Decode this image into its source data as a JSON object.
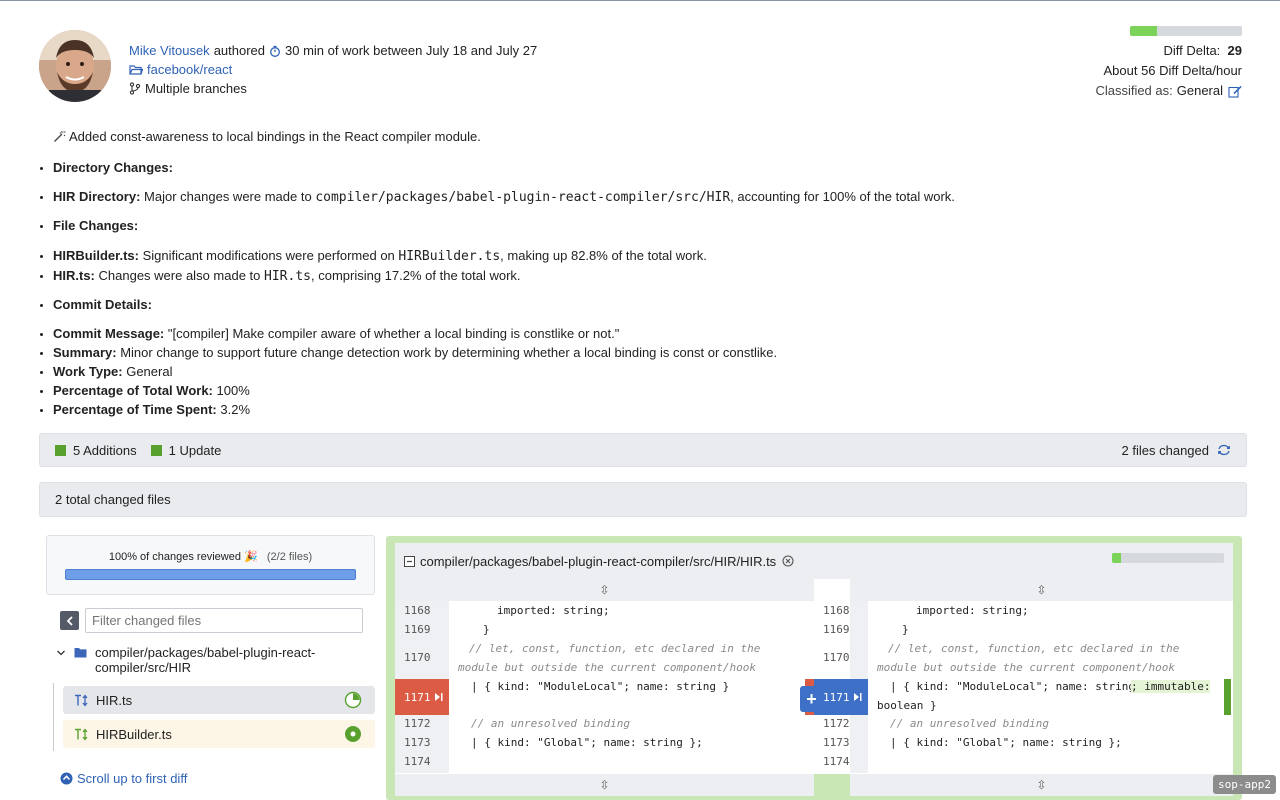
{
  "author": {
    "name": "Mike Vitousek",
    "authored_label": "authored",
    "work_text": "30 min of work between July 18 and July 27",
    "repo": "facebook/react",
    "branches": "Multiple branches"
  },
  "metrics": {
    "diff_delta_label": "Diff Delta:",
    "diff_delta_value": "29",
    "diff_delta_fill": 0.24,
    "rate": "About 56 Diff Delta/hour",
    "classified_label": "Classified as:",
    "classified_value": "General"
  },
  "summary": {
    "lead": "Added const-awareness to local bindings in the React compiler module.",
    "directory_heading": "Directory Changes:",
    "hir_dir_label": "HIR Directory:",
    "hir_dir_pre": "Major changes were made to",
    "hir_dir_path": "compiler/packages/babel-plugin-react-compiler/src/HIR",
    "hir_dir_post": ", accounting for 100% of the total work.",
    "file_heading": "File Changes:",
    "builder_label": "HIRBuilder.ts:",
    "builder_pre": "Significant modifications were performed on",
    "builder_file": "HIRBuilder.ts",
    "builder_post": ", making up 82.8% of the total work.",
    "hir_label": "HIR.ts:",
    "hir_pre": "Changes were also made to",
    "hir_file": "HIR.ts",
    "hir_post": ", comprising 17.2% of the total work.",
    "commit_heading": "Commit Details:",
    "msg_label": "Commit Message:",
    "msg_value": "\"[compiler] Make compiler aware of whether a local binding is constlike or not.\"",
    "sum_label": "Summary:",
    "sum_value": "Minor change to support future change detection work by determining whether a local binding is const or constlike.",
    "type_label": "Work Type:",
    "type_value": "General",
    "pct_work_label": "Percentage of Total Work:",
    "pct_work_value": "100%",
    "pct_time_label": "Percentage of Time Spent:",
    "pct_time_value": "3.2%"
  },
  "changes_bar": {
    "additions": "5 Additions",
    "updates": "1 Update",
    "files_changed": "2 files changed"
  },
  "total_bar": {
    "text": "2 total changed files"
  },
  "review": {
    "text": "100% of changes reviewed 🎉",
    "count": "(2/2 files)",
    "progress": 1.0
  },
  "filter": {
    "placeholder": "Filter changed files"
  },
  "tree": {
    "folder": "compiler/packages/babel-plugin-react-compiler/src/HIR",
    "files": [
      {
        "name": "HIR.ts"
      },
      {
        "name": "HIRBuilder.ts"
      }
    ]
  },
  "scroll_link": "Scroll up to first diff",
  "diff": {
    "path": "compiler/packages/babel-plugin-react-compiler/src/HIR/HIR.ts",
    "progress_fill": 0.08,
    "left_lines": [
      "1168",
      "1169",
      "1170",
      "1171",
      "1172",
      "1173",
      "1174"
    ],
    "right_lines": [
      "1168",
      "1169",
      "1170",
      "1171",
      "1172",
      "1173",
      "1174"
    ],
    "code": {
      "l1168": "imported: string;",
      "l1169": "}",
      "l1170a": "// let, const, function, etc declared in the",
      "l1170b": "module but outside the current component/hook",
      "l1171_left": "| { kind: \"ModuleLocal\"; name: string }",
      "l1171_right_a": "| { kind: \"ModuleLocal\"; name: string",
      "l1171_right_b": "; immutable:",
      "l1171_right_c": "boolean }",
      "l1172": "// an unresolved binding",
      "l1173": "| { kind: \"Global\"; name: string };"
    }
  },
  "env_badge": "sop-app2"
}
